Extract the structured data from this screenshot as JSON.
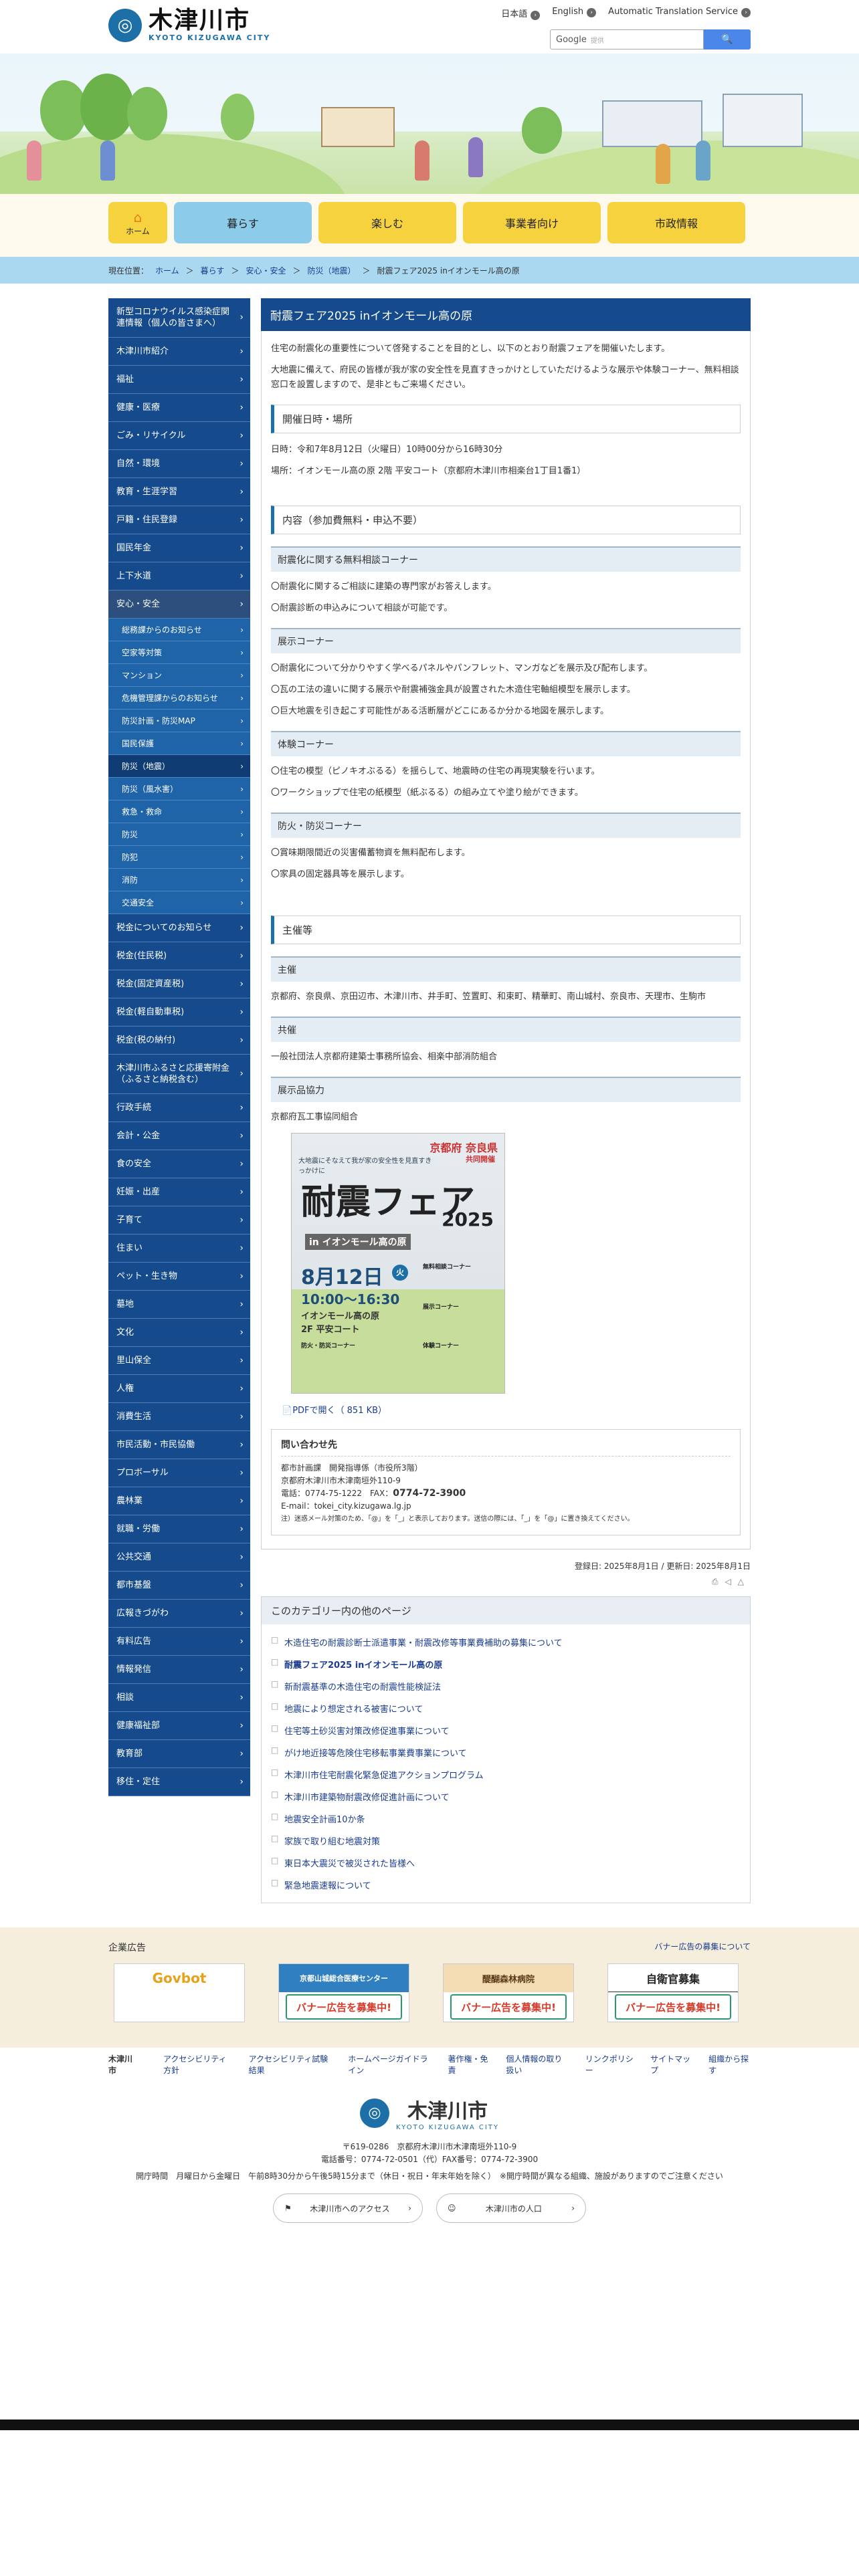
{
  "header": {
    "logo_jp": "木津川市",
    "logo_en": "KYOTO KIZUGAWA CITY",
    "langs": [
      "日本語",
      "English",
      "Automatic Translation Service"
    ],
    "search_label": "Google",
    "search_note": "提供",
    "search_button": "🔍"
  },
  "gnav": {
    "home": "ホーム",
    "items": [
      "暮らす",
      "楽しむ",
      "事業者向け",
      "市政情報"
    ]
  },
  "breadcrumb": {
    "prefix": "現在位置：",
    "items": [
      "ホーム",
      "暮らす",
      "安心・安全",
      "防災（地震）"
    ],
    "current": "耐震フェア2025 inイオンモール高の原"
  },
  "sidebar": {
    "items": [
      "新型コロナウイルス感染症関連情報（個人の皆さまへ）",
      "木津川市紹介",
      "福祉",
      "健康・医療",
      "ごみ・リサイクル",
      "自然・環境",
      "教育・生涯学習",
      "戸籍・住民登録",
      "国民年金",
      "上下水道",
      "安心・安全"
    ],
    "sub": [
      "総務課からのお知らせ",
      "空家等対策",
      "マンション",
      "危機管理課からのお知らせ",
      "防災計画・防災MAP",
      "国民保護",
      "防災（地震）",
      "防災（風水害）",
      "救急・救命",
      "防災",
      "防犯",
      "消防",
      "交通安全"
    ],
    "items2": [
      "税金についてのお知らせ",
      "税金(住民税)",
      "税金(固定資産税)",
      "税金(軽自動車税)",
      "税金(税の納付)",
      "木津川市ふるさと応援寄附金（ふるさと納税含む）",
      "行政手続",
      "会計・公金",
      "食の安全",
      "妊娠・出産",
      "子育て",
      "住まい",
      "ペット・生き物",
      "墓地",
      "文化",
      "里山保全",
      "人権",
      "消費生活",
      "市民活動・市民協働",
      "プロボーサル",
      "農林業",
      "就職・労働",
      "公共交通",
      "都市基盤",
      "広報きづがわ",
      "有料広告",
      "情報発信",
      "相談",
      "健康福祉部",
      "教育部",
      "移住・定住"
    ]
  },
  "article": {
    "title": "耐震フェア2025 inイオンモール高の原",
    "intro1": "住宅の耐震化の重要性について啓発することを目的とし、以下のとおり耐震フェアを開催いたします。",
    "intro2": "大地震に備えて、府民の皆様が我が家の安全性を見直すきっかけとしていただけるような展示や体験コーナー、無料相談窓口を設置しますので、是非ともご来場ください。",
    "h_date": "開催日時・場所",
    "date": "日時：令和7年8月12日（火曜日）10時00分から16時30分",
    "place": "場所：イオンモール高の原 2階 平安コート（京都府木津川市相楽台1丁目1番1）",
    "h_content": "内容（参加費無料・申込不要）",
    "c1_title": "耐震化に関する無料相談コーナー",
    "c1_items": [
      "〇耐震化に関するご相談に建築の専門家がお答えします。",
      "〇耐震診断の申込みについて相談が可能です。"
    ],
    "c2_title": "展示コーナー",
    "c2_items": [
      "〇耐震化について分かりやすく学べるパネルやパンフレット、マンガなどを展示及び配布します。",
      "〇瓦の工法の違いに関する展示や耐震補強金具が設置された木造住宅軸組模型を展示します。",
      "〇巨大地震を引き起こす可能性がある活断層がどこにあるか分かる地図を展示します。"
    ],
    "c3_title": "体験コーナー",
    "c3_items": [
      "〇住宅の模型（ピノキオぶるる）を揺らして、地震時の住宅の再現実験を行います。",
      "〇ワークショップで住宅の紙模型（紙ぶるる）の組み立てや塗り絵ができます。"
    ],
    "c4_title": "防火・防災コーナー",
    "c4_items": [
      "〇賞味期限間近の災害備蓄物資を無料配布します。",
      "〇家具の固定器具等を展示します。"
    ],
    "h_org": "主催等",
    "o1_title": "主催",
    "o1_text": "京都府、奈良県、京田辺市、木津川市、井手町、笠置町、和束町、精華町、南山城村、奈良市、天理市、生駒市",
    "o2_title": "共催",
    "o2_text": "一般社団法人京都府建築士事務所協会、相楽中部消防組合",
    "o3_title": "展示品協力",
    "o3_text": "京都府瓦工事協同組合",
    "poster": {
      "pref": "京都府 奈良県",
      "sub": "共同開催",
      "lead": "大地震にそなえて我が家の安全性を見直すきっかけに",
      "title": "耐震フェア",
      "year": "2025",
      "venue_big": "in イオンモール高の原",
      "date": "8月12日",
      "dow": "火",
      "time": "10:00〜16:30",
      "place": "イオンモール高の原",
      "court": "2F 平安コート",
      "c1": "無料相談コーナー",
      "c2": "展示コーナー",
      "c3": "防火・防災コーナー",
      "c4": "体験コーナー"
    },
    "pdf": "PDFで開く（ 851 KB）",
    "contact_title": "問い合わせ先",
    "contact_lines": [
      "都市計画課　開発指導係（市役所3階）",
      "京都府木津川市木津南垣外110-9",
      "電話：0774-75-1222　FAX：",
      "E-mail：tokei_city.kizugawa.lg.jp",
      "注）迷惑メール対策のため、「@」を「_」と表示しております。送信の際には、「_」を「@」に置き換えてください。"
    ],
    "contact_fax": "0774-72-3900",
    "dates": "登録日: 2025年8月1日 / 更新日: 2025年8月1日",
    "icons": [
      "print-icon",
      "back-icon",
      "top-icon"
    ]
  },
  "category": {
    "title": "このカテゴリー内の他のページ",
    "items": [
      "木造住宅の耐震診断士派遣事業・耐震改修等事業費補助の募集について",
      "耐震フェア2025 inイオンモール高の原",
      "新耐震基準の木造住宅の耐震性能検証法",
      "地震により想定される被害について",
      "住宅等土砂災害対策改修促進事業について",
      "がけ地近接等危険住宅移転事業費事業について",
      "木津川市住宅耐震化緊急促進アクションプログラム",
      "木津川市建築物耐震改修促進計画について",
      "地震安全計画10か条",
      "家族で取り組む地震対策",
      "東日本大震災で被災された皆様へ",
      "緊急地震速報について"
    ],
    "current": 1
  },
  "ads": {
    "title": "企業広告",
    "recruit": "バナー広告の募集について",
    "banners": [
      {
        "top": "Govbot",
        "bot": ""
      },
      {
        "top": "京都山城総合医療センター",
        "bot": "バナー広告を募集中!"
      },
      {
        "top": "醍醐森林病院",
        "bot": "バナー広告を募集中!"
      },
      {
        "top": "自衛官募集",
        "bot": "バナー広告を募集中!"
      }
    ]
  },
  "footer": {
    "name": "木津川市",
    "links": [
      "アクセシビリティ方針",
      "アクセシビリティ試験結果",
      "ホームページガイドライン",
      "著作権・免責",
      "個人情報の取り扱い",
      "リンクポリシー",
      "サイトマップ",
      "組織から探す"
    ],
    "addr": "〒619-0286　京都府木津川市木津南垣外110-9",
    "tel": "電話番号：0774-72-0501（代）FAX番号：0774-72-3900",
    "hours": "開庁時間　月曜日から金曜日　午前8時30分から午後5時15分まで（休日・祝日・年末年始を除く）　※開庁時間が異なる組織、施設がありますのでご注意ください",
    "btn1": "木津川市へのアクセス",
    "btn2": "木津川市の人口"
  }
}
